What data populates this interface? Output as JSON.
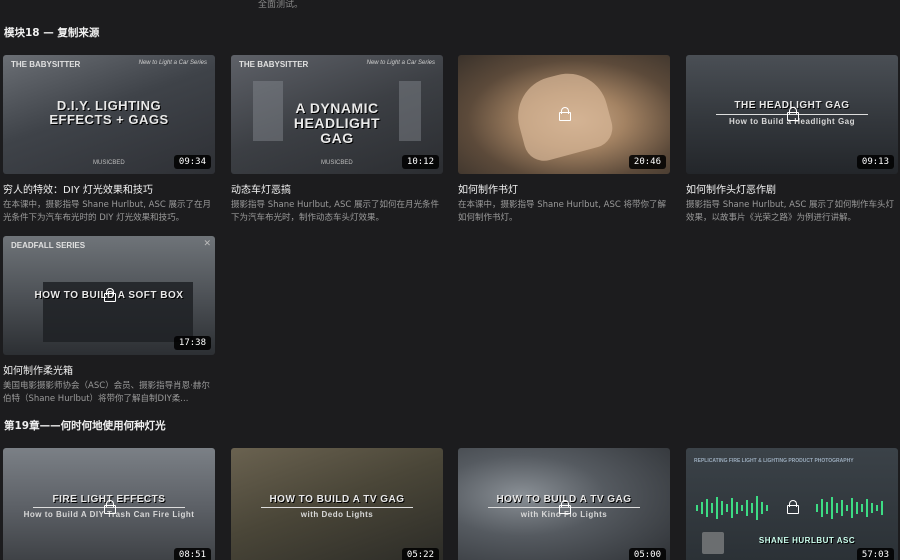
{
  "top_clip_text": "全面测试。",
  "sections": [
    {
      "title": "模块18 — 复制来源"
    },
    {
      "title": "第19章——何时何地使用何种灯光"
    }
  ],
  "cards": [
    {
      "title": "穷人的特效：DIY 灯光效果和技巧",
      "desc": "在本课中，摄影指导 Shane Hurlbut, ASC 展示了在月光条件下为汽车布光时的 DIY 灯光效果和技巧。",
      "duration": "09:34",
      "thumb_top_left": "THE BABYSITTER",
      "thumb_top_right": "New to Light a Car Series",
      "thumb_big": "D.I.Y. LIGHTING EFFECTS + GAGS",
      "thumb_bottom": "MUSICBED",
      "locked": false
    },
    {
      "title": "动态车灯恶搞",
      "desc": "摄影指导 Shane Hurlbut, ASC 展示了如何在月光条件下为汽车布光时，制作动态车头灯效果。",
      "duration": "10:12",
      "thumb_top_left": "THE BABYSITTER",
      "thumb_top_right": "New to Light a Car Series",
      "thumb_big": "A DYNAMIC HEADLIGHT GAG",
      "thumb_bottom": "MUSICBED",
      "locked": false
    },
    {
      "title": "如何制作书灯",
      "desc": "在本课中，摄影指导 Shane Hurlbut, ASC 将带你了解如何制作书灯。",
      "duration": "20:46",
      "locked": true
    },
    {
      "title": "如何制作头灯恶作剧",
      "desc": "摄影指导 Shane Hurlbut, ASC 展示了如何制作车头灯效果，以故事片《光荣之路》为例进行讲解。",
      "duration": "09:13",
      "thumb_big": "THE HEADLIGHT GAG",
      "thumb_sub": "How to Build a Headlight Gag",
      "locked": true
    },
    {
      "title": "如何制作柔光箱",
      "desc": "美国电影摄影师协会（ASC）会员、摄影指导肖恩·赫尔伯特（Shane Hurlbut）将带你了解自制DIY柔...",
      "duration": "17:38",
      "thumb_top_left": "DEADFALL SERIES",
      "thumb_big": "HOW TO BUILD A SOFT BOX",
      "locked": true
    },
    {
      "duration": "08:51",
      "thumb_big": "FIRE LIGHT EFFECTS",
      "thumb_sub": "How to Build A DIY Trash Can Fire Light",
      "locked": true
    },
    {
      "duration": "05:22",
      "thumb_big": "HOW TO BUILD A TV GAG",
      "thumb_sub": "with Dedo Lights",
      "locked": true
    },
    {
      "duration": "05:00",
      "thumb_big": "HOW TO BUILD A TV GAG",
      "thumb_sub": "with Kino Flo Lights",
      "locked": true
    },
    {
      "duration": "57:03",
      "thumb_top_left": "REPLICATING FIRE LIGHT & LIGHTING PRODUCT PHOTOGRAPHY",
      "thumb_big": "SHANE HURLBUT ASC",
      "locked": true
    }
  ],
  "colors": {
    "background": "#1c1c1e",
    "title_text": "#f2f2f2",
    "desc_text": "#9a9a9a",
    "duration_bg": "#000000",
    "wave_green": "#3ddc84"
  }
}
